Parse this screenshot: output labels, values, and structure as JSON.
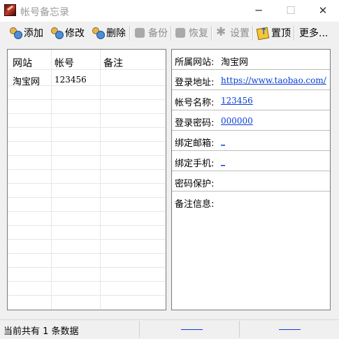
{
  "window": {
    "title": "帐号备忘录"
  },
  "toolbar": [
    {
      "label": "添加",
      "icon": "add-user-icon",
      "enabled": true
    },
    {
      "label": "修改",
      "icon": "edit-user-icon",
      "enabled": true
    },
    {
      "label": "删除",
      "icon": "delete-user-icon",
      "enabled": true
    },
    {
      "label": "备份",
      "icon": "backup-icon",
      "enabled": false
    },
    {
      "label": "恢复",
      "icon": "restore-icon",
      "enabled": false
    },
    {
      "label": "设置",
      "icon": "gear-icon",
      "enabled": false
    },
    {
      "label": "置顶",
      "icon": "pin-top-icon",
      "enabled": true
    },
    {
      "label": "更多...",
      "icon": "",
      "enabled": true
    }
  ],
  "list": {
    "columns": [
      "网站",
      "帐号",
      "备注"
    ],
    "rows": [
      {
        "site": "淘宝网",
        "account": "123456",
        "note": ""
      }
    ]
  },
  "details": [
    {
      "label": "所属网站:",
      "value": "淘宝网",
      "link": false
    },
    {
      "label": "登录地址:",
      "value": "https://www.taobao.com/",
      "link": true
    },
    {
      "label": "帐号名称:",
      "value": "123456",
      "link": true
    },
    {
      "label": "登录密码:",
      "value": "000000",
      "link": true
    },
    {
      "label": "绑定邮箱:",
      "value": "_",
      "link": true
    },
    {
      "label": "绑定手机:",
      "value": "_",
      "link": true
    },
    {
      "label": "密码保护:",
      "value": "",
      "link": false
    },
    {
      "label": "备注信息:",
      "value": "",
      "link": false
    }
  ],
  "status": {
    "text": "当前共有 1 条数据"
  },
  "colors": {
    "link": "#0a3cd6",
    "background": "#f0f0f0"
  }
}
